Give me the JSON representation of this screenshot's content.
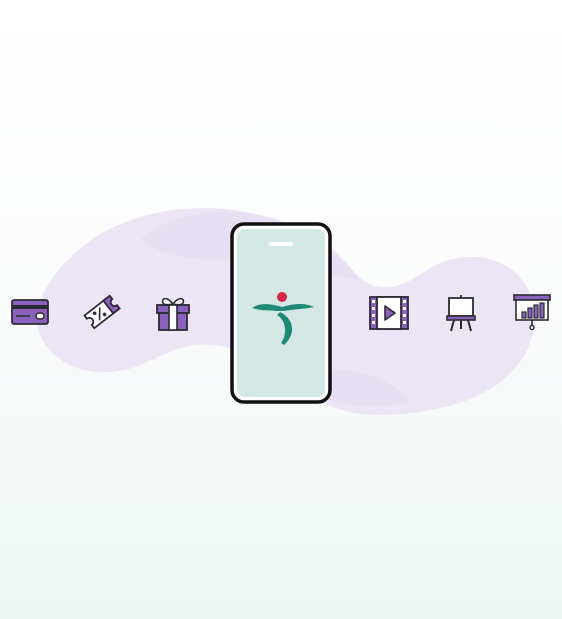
{
  "colors": {
    "background_top": "#ffffff",
    "background_bottom": "#eef6f4",
    "blob": "#ece5f6",
    "icon_purple": "#8a62bd",
    "icon_stroke": "#2b2b33",
    "phone_screen": "#d3e8e4",
    "phone_frame": "#111111",
    "logo_teal": "#1f8a73",
    "logo_red": "#d7264a"
  },
  "icons": [
    {
      "name": "credit-card-icon"
    },
    {
      "name": "discount-coupon-icon"
    },
    {
      "name": "gift-box-icon"
    },
    {
      "name": "video-play-icon"
    },
    {
      "name": "easel-icon"
    },
    {
      "name": "presentation-chart-icon"
    }
  ],
  "phone": {
    "logo": "bank-logo"
  }
}
